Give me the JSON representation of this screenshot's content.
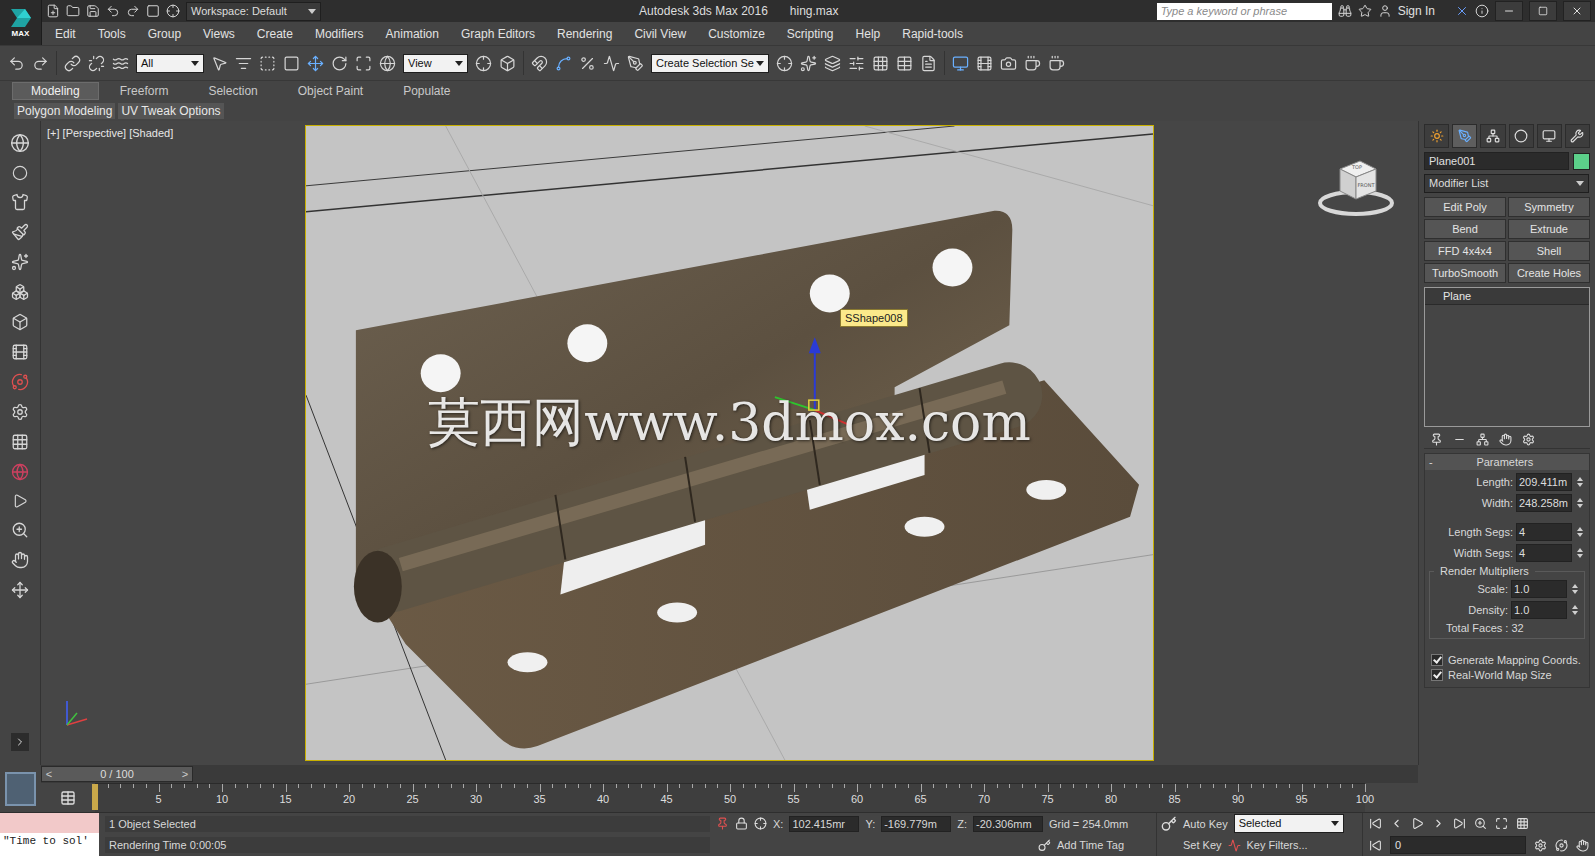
{
  "window": {
    "title": "Autodesk 3ds Max 2016",
    "file": "hing.max",
    "workspace": "Workspace: Default"
  },
  "search": {
    "placeholder": "Type a keyword or phrase"
  },
  "account": {
    "label": "Sign In"
  },
  "logo": "MAX",
  "menu": [
    "Edit",
    "Tools",
    "Group",
    "Views",
    "Create",
    "Modifiers",
    "Animation",
    "Graph Editors",
    "Rendering",
    "Civil View",
    "Customize",
    "Scripting",
    "Help",
    "Rapid-tools"
  ],
  "toolbar": {
    "filter": "All",
    "coord_system": "View",
    "selection_set": "Create Selection Se"
  },
  "ribbon_tabs": [
    {
      "label": "Modeling",
      "selected": true
    },
    {
      "label": "Freeform",
      "selected": false
    },
    {
      "label": "Selection",
      "selected": false
    },
    {
      "label": "Object Paint",
      "selected": false
    },
    {
      "label": "Populate",
      "selected": false
    }
  ],
  "ribbon_panels": [
    "Polygon Modeling",
    "UV Tweak Options"
  ],
  "viewport": {
    "label": "[+] [Perspective] [Shaded]",
    "tooltip": "SShape008",
    "watermark": "莫西网www.3dmox.com",
    "viewcube_faces": [
      "FRONT",
      "TOP"
    ]
  },
  "command_panel": {
    "object_name": "Plane001",
    "object_color": "#5cd08a",
    "modifier_list": "Modifier List",
    "modifier_buttons": [
      "Edit Poly",
      "Symmetry",
      "Bend",
      "Extrude",
      "FFD 4x4x4",
      "Shell",
      "TurboSmooth",
      "Create Holes"
    ],
    "stack": [
      {
        "label": "Plane",
        "selected": false
      }
    ],
    "parameters": {
      "toggle": "-",
      "title": "Parameters",
      "fields": [
        {
          "label": "Length:",
          "value": "209.411m"
        },
        {
          "label": "Width:",
          "value": "248.258m"
        },
        {
          "label": "Length Segs:",
          "value": "4"
        },
        {
          "label": "Width Segs:",
          "value": "4"
        }
      ],
      "group": "Render Multipliers",
      "group_fields": [
        {
          "label": "Scale:",
          "value": "1.0"
        },
        {
          "label": "Density:",
          "value": "1.0"
        }
      ],
      "total_faces": "Total Faces : 32",
      "checkboxes": [
        {
          "label": "Generate Mapping Coords.",
          "checked": true
        },
        {
          "label": "Real-World Map Size",
          "checked": true
        }
      ]
    }
  },
  "timeline": {
    "frame": "0 / 100",
    "level": 0,
    "prev": "<",
    "next": ">",
    "ticks": [
      "5",
      "10",
      "15",
      "20",
      "25",
      "30",
      "35",
      "40",
      "45",
      "50",
      "55",
      "60",
      "65",
      "70",
      "75",
      "80",
      "85",
      "90",
      "95",
      "100"
    ]
  },
  "status": {
    "maxscript": "\"Time to sol'",
    "selection": "1 Object Selected",
    "render_time": "Rendering Time  0:00:05",
    "coords": [
      {
        "axis": "X:",
        "value": "102.415mr"
      },
      {
        "axis": "Y:",
        "value": "-169.779m"
      },
      {
        "axis": "Z:",
        "value": "-20.306mm"
      }
    ],
    "grid": "Grid = 254.0mm",
    "time_tag": "Add Time Tag",
    "auto_key": "Auto Key",
    "key_mode": "Selected",
    "set_key": "Set Key",
    "key_filters": "Key Filters...",
    "current_frame": "0"
  }
}
